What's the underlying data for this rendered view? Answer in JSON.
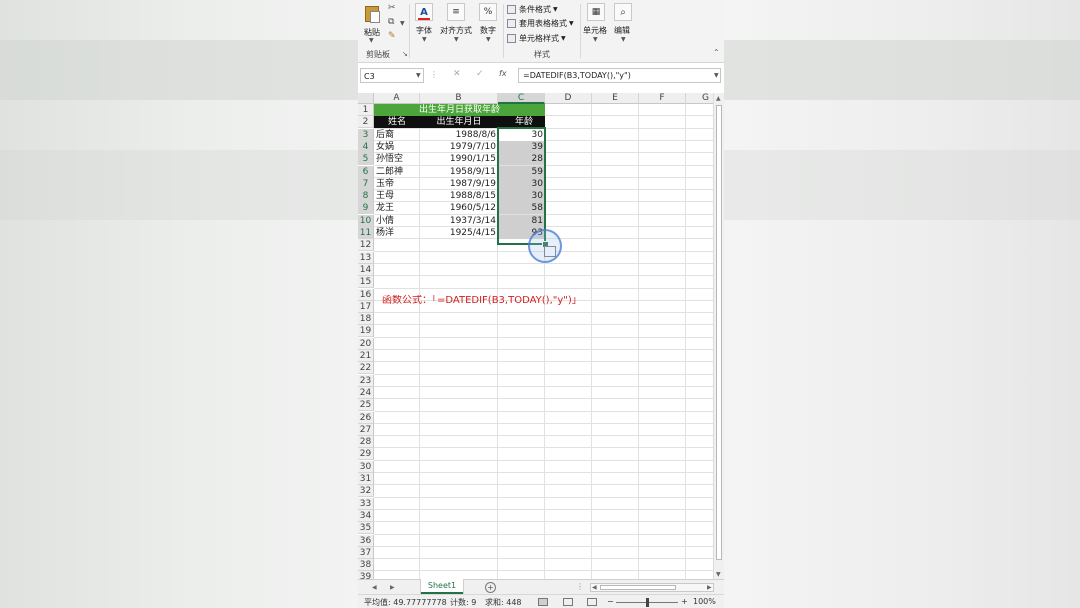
{
  "ribbon": {
    "paste_label": "粘贴",
    "clipboard_group": "剪贴板",
    "font_label": "字体",
    "align_label": "对齐方式",
    "number_label": "数字",
    "cond_format": "条件格式",
    "table_format": "套用表格格式",
    "cell_styles": "单元格样式",
    "styles_group": "样式",
    "cells_label": "单元格",
    "edit_label": "编辑",
    "font_icon_glyph": "A",
    "number_icon_glyph": "%"
  },
  "formula_bar": {
    "name_box": "C3",
    "fx": "fx",
    "formula": "=DATEDIF(B3,TODAY(),\"y\")"
  },
  "grid": {
    "columns": [
      "A",
      "B",
      "C",
      "D",
      "E",
      "F",
      "G"
    ],
    "rows": [
      "1",
      "2",
      "3",
      "4",
      "5",
      "6",
      "7",
      "8",
      "9",
      "10",
      "11",
      "12",
      "13",
      "14",
      "15",
      "16",
      "17",
      "18",
      "19",
      "20",
      "21",
      "22",
      "23",
      "24",
      "25",
      "26",
      "27",
      "28",
      "29",
      "30",
      "31",
      "32",
      "33",
      "34",
      "35",
      "36",
      "37",
      "38",
      "39"
    ],
    "selected_column": "C",
    "title": "出生年月日获取年龄",
    "headers": [
      "姓名",
      "出生年月日",
      "年龄"
    ],
    "data_rows": [
      {
        "name": "后裔",
        "birth": "1988/8/6",
        "age": "30"
      },
      {
        "name": "女娲",
        "birth": "1979/7/10",
        "age": "39"
      },
      {
        "name": "孙悟空",
        "birth": "1990/1/15",
        "age": "28"
      },
      {
        "name": "二郎神",
        "birth": "1958/9/11",
        "age": "59"
      },
      {
        "name": "玉帝",
        "birth": "1987/9/19",
        "age": "30"
      },
      {
        "name": "王母",
        "birth": "1988/8/15",
        "age": "30"
      },
      {
        "name": "龙王",
        "birth": "1960/5/12",
        "age": "58"
      },
      {
        "name": "小倩",
        "birth": "1937/3/14",
        "age": "81"
      },
      {
        "name": "杨洋",
        "birth": "1925/4/15",
        "age": "93"
      }
    ],
    "note": "函数公式：「=DATEDIF(B3,TODAY(),\"y\")」"
  },
  "sheet_tab": "Sheet1",
  "status": {
    "average": "平均值: 49.77777778",
    "count": "计数: 9",
    "sum": "求和: 448",
    "zoom": "100%"
  },
  "colors": {
    "excel_green": "#217346",
    "title_fill": "#4ba53a",
    "header_fill": "#0f0f0f",
    "note_red": "#d11f1f"
  }
}
